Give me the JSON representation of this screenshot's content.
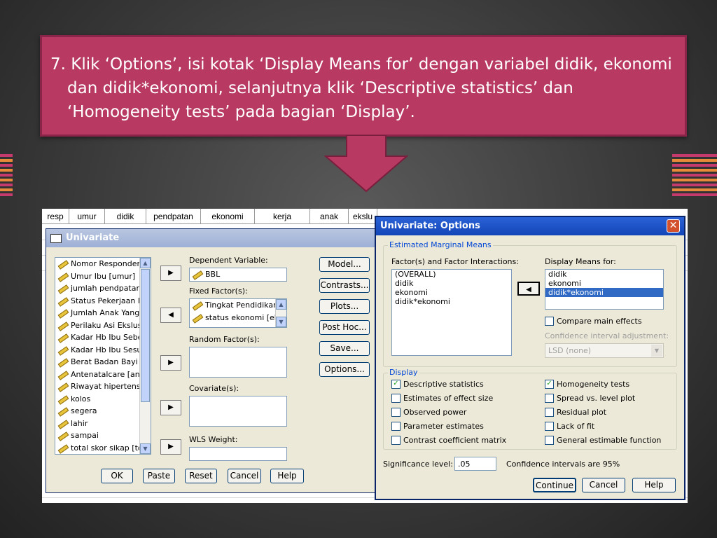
{
  "instruction": {
    "text": "7. Klik ‘Options’, isi kotak ‘Display Means for’ dengan variabel didik, ekonomi dan didik*ekonomi, selanjutnya klik ‘Descriptive statistics’ dan ‘Homogeneity tests’ pada bagian ‘Display’."
  },
  "sheet": {
    "columns": [
      "resp",
      "umur",
      "didik",
      "pendpatan",
      "ekonomi",
      "kerja",
      "anak",
      "ekslu"
    ]
  },
  "univariate": {
    "title": "Univariate",
    "variables": [
      "Nomor Responden",
      "Umur Ibu [umur]",
      "jumlah pendpatan",
      "Status Pekerjaan I",
      "Jumlah Anak Yang",
      "Perilaku Asi Ekslus",
      "Kadar Hb Ibu Sebe",
      "Kadar Hb Ibu Sesu",
      "Berat Badan Bayi [",
      "Antenatalcare [anc",
      "Riwayat hipertensi",
      "kolos",
      "segera",
      "lahir",
      "sampai",
      "total skor sikap [tot"
    ],
    "dependent_label": "Dependent Variable:",
    "dependent_value": "BBL",
    "fixed_label": "Fixed Factor(s):",
    "fixed_items": [
      "Tingkat Pendidikan",
      "status ekonomi [ek"
    ],
    "random_label": "Random Factor(s):",
    "covariate_label": "Covariate(s):",
    "wls_label": "WLS Weight:",
    "side_buttons": [
      "Model...",
      "Contrasts...",
      "Plots...",
      "Post Hoc...",
      "Save...",
      "Options..."
    ],
    "bottom_buttons": [
      "OK",
      "Paste",
      "Reset",
      "Cancel",
      "Help"
    ]
  },
  "options": {
    "title": "Univariate: Options",
    "emm_legend": "Estimated Marginal Means",
    "factors_label": "Factor(s) and Factor Interactions:",
    "factors": [
      "(OVERALL)",
      "didik",
      "ekonomi",
      "didik*ekonomi"
    ],
    "display_means_label": "Display Means for:",
    "display_means": [
      "didik",
      "ekonomi",
      "didik*ekonomi"
    ],
    "display_means_selected": 2,
    "compare_main": "Compare main effects",
    "ci_adj_label": "Confidence interval adjustment:",
    "ci_adj_value": "LSD (none)",
    "display_legend": "Display",
    "display_left": [
      {
        "label": "Descriptive statistics",
        "checked": true
      },
      {
        "label": "Estimates of effect size",
        "checked": false
      },
      {
        "label": "Observed power",
        "checked": false
      },
      {
        "label": "Parameter estimates",
        "checked": false
      },
      {
        "label": "Contrast coefficient matrix",
        "checked": false
      }
    ],
    "display_right": [
      {
        "label": "Homogeneity tests",
        "checked": true
      },
      {
        "label": "Spread vs. level plot",
        "checked": false
      },
      {
        "label": "Residual plot",
        "checked": false
      },
      {
        "label": "Lack of fit",
        "checked": false
      },
      {
        "label": "General estimable function",
        "checked": false
      }
    ],
    "sig_label": "Significance level:",
    "sig_value": ".05",
    "ci_text": "Confidence intervals are 95%",
    "buttons": [
      "Continue",
      "Cancel",
      "Help"
    ]
  },
  "colors": {
    "instruction_bg": "#b83a63",
    "title_blue": "#0a246a",
    "selection": "#316ac5"
  }
}
